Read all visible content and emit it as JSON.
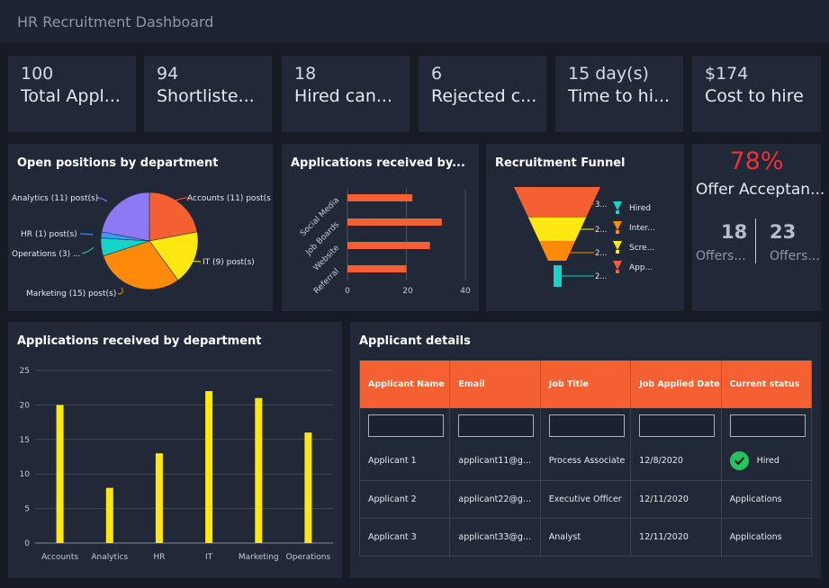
{
  "header": {
    "title": "HR Recruitment Dashboard"
  },
  "kpis": [
    {
      "value": "100",
      "label": "Total Appl..."
    },
    {
      "value": "94",
      "label": "Shortliste..."
    },
    {
      "value": "18",
      "label": "Hired can..."
    },
    {
      "value": "6",
      "label": "Rejected c..."
    },
    {
      "value": "15 day(s)",
      "label": "Time to hi..."
    },
    {
      "value": "$174",
      "label": "Cost to hire"
    }
  ],
  "colors": {
    "accent": "#f46032",
    "bar_yellow": "#ffe712",
    "offer_red": "#e8333a",
    "success": "#22c55e",
    "pie": [
      "#f46032",
      "#ffe712",
      "#ff8a0a",
      "#17d4c8",
      "#3aa0ff",
      "#8e79f5"
    ],
    "funnel": [
      "#f46032",
      "#ffe712",
      "#ff8a0a",
      "#17d4c8"
    ]
  },
  "open_positions": {
    "title": "Open positions by department",
    "labels": [
      "Accounts (11) post(s",
      "IT (9) post(s)",
      "Marketing (15) post(s)",
      "Operations (3) ...",
      "HR (1) post(s)",
      "Analytics (11) post(s)"
    ]
  },
  "applications_by_source": {
    "title": "Applications received by...",
    "ticks": [
      "0",
      "20",
      "40"
    ]
  },
  "funnel": {
    "title": "Recruitment Funnel",
    "value_labels": [
      "3...",
      "2...",
      "2...",
      "2..."
    ],
    "legend": [
      "Hired",
      "Inter...",
      "Scre...",
      "App..."
    ]
  },
  "offer": {
    "percent": "78%",
    "label": "Offer Acceptan...",
    "stats": [
      {
        "value": "18",
        "label": "Offers..."
      },
      {
        "value": "23",
        "label": "Offers..."
      }
    ]
  },
  "applications_by_dept": {
    "title": "Applications received by department"
  },
  "applicant_details": {
    "title": "Applicant details",
    "columns": [
      "Applicant Name",
      "Email",
      "Job Title",
      "Job Applied Date",
      "Current status"
    ],
    "rows": [
      {
        "name": "Applicant 1",
        "email": "applicant11@g...",
        "job": "Process Associate",
        "date": "12/8/2020",
        "status": "Hired"
      },
      {
        "name": "Applicant 2",
        "email": "applicant22@g...",
        "job": "Executive Officer",
        "date": "12/11/2020",
        "status": "Applications"
      },
      {
        "name": "Applicant 3",
        "email": "applicant33@g...",
        "job": "Analyst",
        "date": "12/11/2020",
        "status": "Applications"
      }
    ]
  },
  "chart_data": [
    {
      "type": "pie",
      "categories": [
        "Accounts",
        "IT",
        "Marketing",
        "Operations",
        "HR",
        "Analytics"
      ],
      "values": [
        11,
        9,
        15,
        3,
        1,
        11
      ],
      "title": "Open positions by department"
    },
    {
      "type": "bar",
      "orientation": "horizontal",
      "categories": [
        "Social Media",
        "Job Boards",
        "Website",
        "Referral"
      ],
      "values": [
        22,
        32,
        28,
        20
      ],
      "xlim": [
        0,
        40
      ],
      "title": "Applications received by..."
    },
    {
      "type": "bar",
      "categories": [
        "Accounts",
        "Analytics",
        "HR",
        "IT",
        "Marketing",
        "Operations"
      ],
      "values": [
        20,
        8,
        13,
        22,
        21,
        16
      ],
      "ylim": [
        0,
        25
      ],
      "yticks": [
        0,
        5,
        10,
        15,
        20,
        25
      ],
      "grid": true,
      "title": "Applications received by department"
    }
  ]
}
